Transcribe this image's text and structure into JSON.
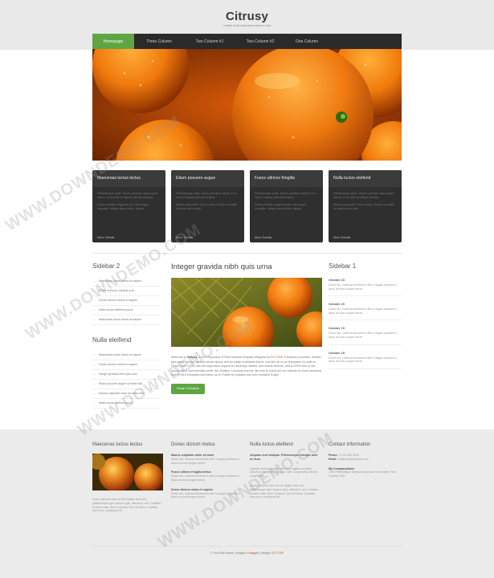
{
  "header": {
    "title": "Citrusy",
    "tagline": "collect from www.downdemo.com"
  },
  "nav": [
    {
      "label": "Homepage",
      "active": true
    },
    {
      "label": "Three Column",
      "active": false
    },
    {
      "label": "Two Column #1",
      "active": false
    },
    {
      "label": "Two Column #2",
      "active": false
    },
    {
      "label": "One Column",
      "active": false
    }
  ],
  "features": [
    {
      "title": "Maecenas luctus lectus",
      "text1": "Pellentesque pede. Donec pulvinar ullamcorper metus. In eu odio et massa ultricies tempus.",
      "text2": "Donec facilisis magna at dui, velit augue convallis. Integer lacus tellus, aliquet.",
      "more": "More Details"
    },
    {
      "title": "Etiam posuere augue",
      "text1": "Pellentesque pede. Donec pulvinar metus. In eu odio et massa ultricies tempus.",
      "text2": "Mauris quis pede. Cras et sem. Donec convallis sit amet orci in nibh.",
      "more": "More Details"
    },
    {
      "title": "Fusce ultrices fringilla",
      "text1": "Pellentesque pede. Donec pulvinar metus. In eu odio et massa ultricies tempus.",
      "text2": "Donec facilisis magna at dui, velit augue convallis. Integer lacus tellus, aliquet.",
      "more": "More Details"
    },
    {
      "title": "Nulla luctus eleifend",
      "text1": "Pellentesque pede. Donec pulvinar ullamcorper metus. In eu odio et massa ultricies.",
      "text2": "Mauris quis pede. Cras et sem. Donec convallis sit amet orci in nibh.",
      "more": "More Details"
    }
  ],
  "left_sidebar": {
    "heading1": "Sidebar 2",
    "list1": [
      "Maecenas luctus lectus at sapien",
      "Etiam rhoncus volutpat erat",
      "Donec dictum metus in sapien",
      "Nulla luctus eleifend purus",
      "Maecenas luctus lectus at sapien"
    ],
    "heading2": "Nulla eleifend",
    "list2": [
      "Maecenas luctus lectus at sapien",
      "Donec dictum metus in sapien",
      "Integer gravida nibh quis urna",
      "Etiam posuere augue sit amet nisl",
      "Mauris vulputate dolor sit amet nibh",
      "Nulla luctus eleifend purus"
    ]
  },
  "main": {
    "heading": "Integer gravida nibh quis urna",
    "paragraph_pre": "Welcome to ",
    "paragraph_bold": "Citrusy",
    "paragraph_mid": ", a free responsive HTML5 website template designed by ",
    "paragraph_link": "FCT.CSS",
    "paragraph_post": ". It features a modern, flexible, grid-based design, content-dense layout, and an easily modifiable theme. And like all of our templates, it's built on HTML5 and CSS3, has full responsive support for desktops, tablets, and mobile devices, and is 100% free to use personally or commercially under the Creative Commons license. Be sure to check out our website for more awesome free HTML5 templates and follow us on Twitter for updates and new releases! Enjoy!",
    "button": "Read Full Article"
  },
  "right_sidebar": {
    "heading": "Sidebar 1",
    "items": [
      {
        "date": "October 23",
        "text": "Donec leo, vivamus fermentum nibh in augue praesent a lacus at urna congue rutrum."
      },
      {
        "date": "October 20",
        "text": "Donec leo, vivamus fermentum nibh in augue praesent a lacus at urna congue rutrum."
      },
      {
        "date": "October 19",
        "text": "Donec leo, vivamus fermentum nibh in augue praesent a lacus at urna congue rutrum."
      },
      {
        "date": "October 15",
        "text": "Donec leo, vivamus fermentum nibh in augue praesent a lacus at urna congue rutrum."
      }
    ]
  },
  "footer": {
    "col1_heading": "Maecenas luctus lectus",
    "col1_text": "Donec placerat odio vel elit. Nullam ante orci, pellentesque eget, tempus quis, ultrices in, est. Curabitur sit amet nulla. Nam in massa. Sed vel tellus. Curabitur sem urna, consequat vel.",
    "col2_heading": "Donec dictum metus",
    "col2_items": [
      {
        "title": "Mauris vulputate dolor sit amet",
        "text": "Donec leo, vivamus fermentum nibh in augue praesent a lacus at urna congue rutrum."
      },
      {
        "title": "Fusce ultrices fringilla metus",
        "text": "Donec leo, vivamus fermentum nibh in augue praesent a lacus at urna congue rutrum."
      },
      {
        "title": "Donec dictum metus in sapien",
        "text": "Donec leo, vivamus fermentum nibh in augue praesent a lacus at urna congue rutrum."
      }
    ],
    "col3_heading": "Nulla luctus eleifend",
    "col3_bold": "Aliquam erat volutpat. Pellentesque tristique ante ut risus.",
    "col3_text1": "Quisque dictum. Integer nisl risus, sagittis convallis, rutrum id, elementum congue, nibh. Suspendisse dictum porta lectus.",
    "col3_text2": "Donec placerat odio vel elit. Nullam ante orci, pellentesque eget, tempus quis, ultrices in, est. Curabitur sit amet nulla. Nam in massa. Sed vel tellus. Curabitur sem urna, consequat vel.",
    "col4_heading": "Contact Information",
    "phone_label": "Phone:",
    "phone": "+1 234 567 8910",
    "email_label": "Email:",
    "email": "info@companyname.com",
    "company": "My CompanyName",
    "address": "1234 Pellentesque Avenue Ipsum and more State, Post Country 1234"
  },
  "copyright": {
    "pre": "© Your Site Name | Images: ",
    "link1": "Fotogrph",
    "mid": " | Design: ",
    "link2": "FCT.CSS"
  },
  "watermark": "WWW.DOWNDEMO.COM",
  "colors": {
    "accent": "#5ea544",
    "nav": "#2a2a2a",
    "link": "#c04a1a"
  }
}
